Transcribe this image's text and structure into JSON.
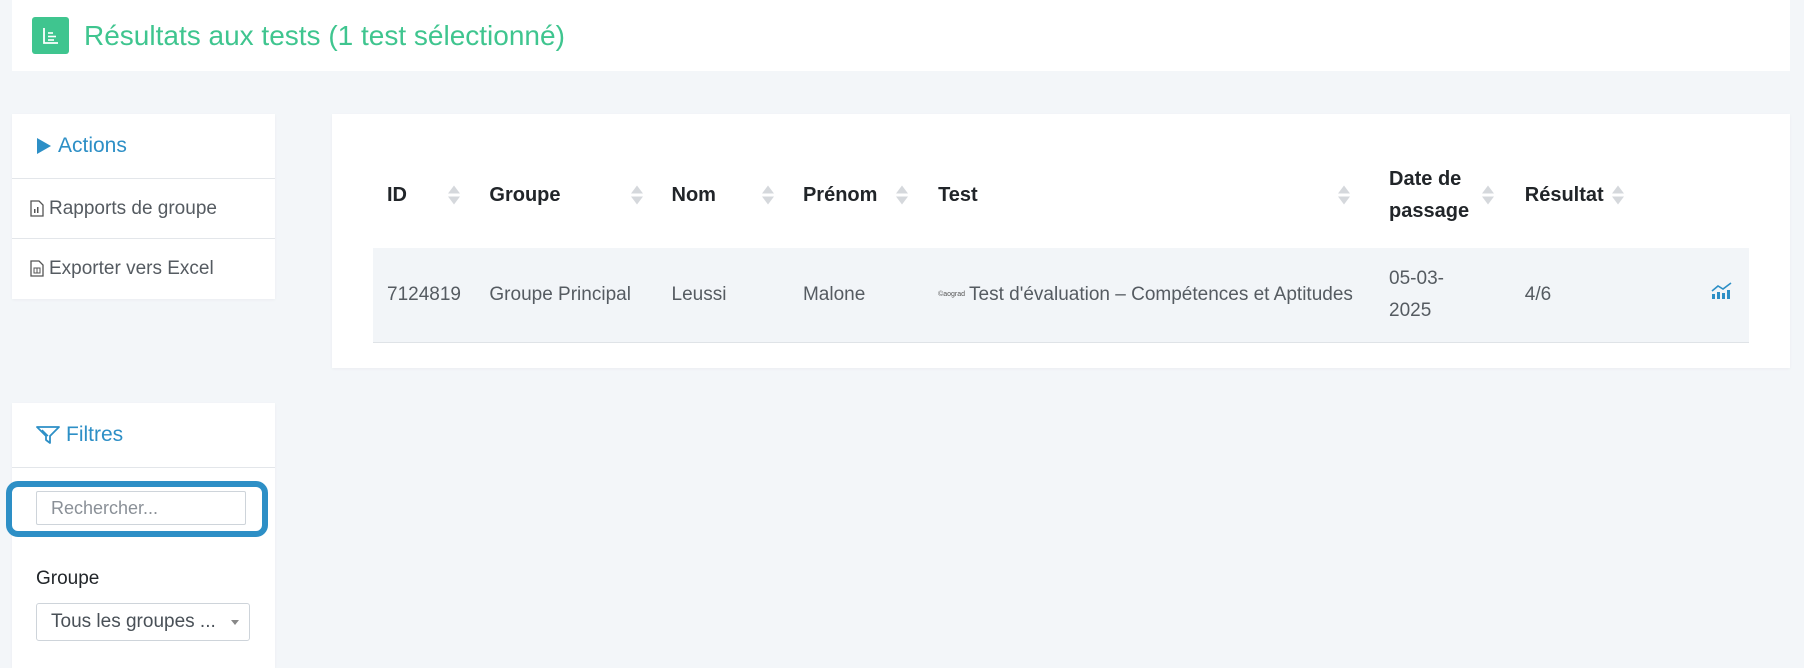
{
  "header": {
    "title": "Résultats aux tests (1 test sélectionné)",
    "icon": "report-icon"
  },
  "actions": {
    "title": "Actions",
    "items": [
      {
        "label": "Rapports de groupe",
        "icon": "document-icon"
      },
      {
        "label": "Exporter vers Excel",
        "icon": "excel-icon"
      }
    ]
  },
  "filters": {
    "title": "Filtres",
    "search_placeholder": "Rechercher...",
    "group_label": "Groupe",
    "group_selected": "Tous les groupes ..."
  },
  "table": {
    "columns": [
      "ID",
      "Groupe",
      "Nom",
      "Prénom",
      "Test",
      "Date de passage",
      "Résultat"
    ],
    "rows": [
      {
        "id": "7124819",
        "groupe": "Groupe Principal",
        "nom": "Leussi",
        "prenom": "Malone",
        "test_logo": "©aograd",
        "test": "Test d'évaluation – Compétences et Aptitudes",
        "date": "05-03-2025",
        "resultat": "4/6",
        "action_icon": "chart-icon"
      }
    ]
  },
  "colors": {
    "accent_green": "#3fc58f",
    "accent_blue": "#2d8fc6"
  }
}
